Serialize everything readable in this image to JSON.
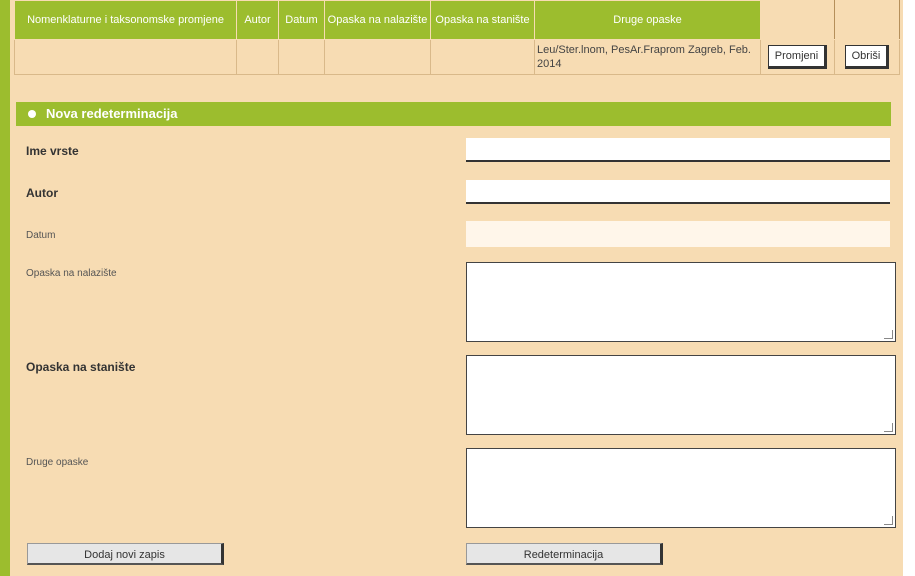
{
  "table": {
    "headers": [
      "Nomenklaturne i taksonomske promjene",
      "Autor",
      "Datum",
      "Opaska na nalazište",
      "Opaska na stanište",
      "Druge opaske",
      "",
      ""
    ],
    "row": {
      "notes": "Leu/Ster.lnom, PesAr.Fraprom Zagreb, Feb. 2014",
      "edit_button": "Promjeni",
      "delete_button": "Obriši"
    }
  },
  "section": {
    "title": "Nova redeterminacija"
  },
  "form": {
    "species_label": "Ime vrste",
    "author_label": "Autor",
    "date_label": "Datum",
    "site_note_label": "Opaska na nalazište",
    "habitat_note_label": "Opaska na stanište",
    "other_notes_label": "Druge opaske"
  },
  "buttons": {
    "save": "Dodaj novi zapis",
    "cancel": "Redeterminacija"
  },
  "colors": {
    "accent": "#9cbd2e",
    "panel": "#f7dcb3"
  }
}
